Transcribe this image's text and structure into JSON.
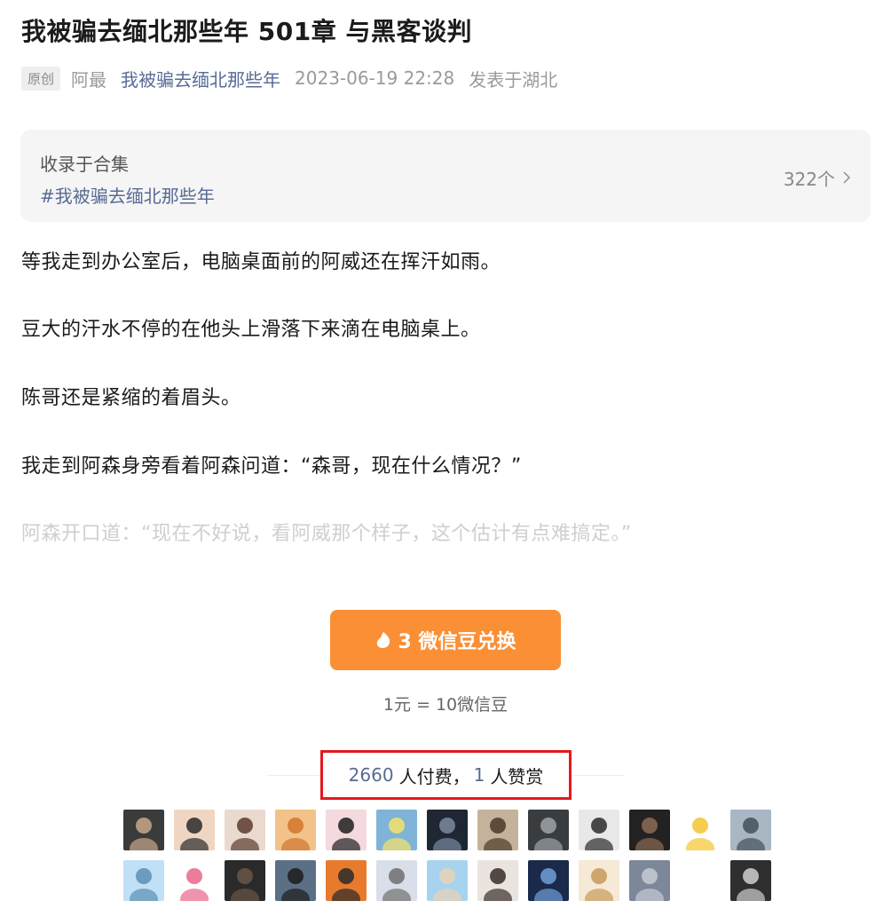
{
  "article": {
    "title": "我被骗去缅北那些年 501章 与黑客谈判",
    "original_tag": "原创",
    "author": "阿最",
    "account": "我被骗去缅北那些年",
    "datetime": "2023-06-19 22:28",
    "location": "发表于湖北"
  },
  "collection": {
    "label": "收录于合集",
    "tag": "#我被骗去缅北那些年",
    "count": "322个",
    "chevron_icon": "chevron-right-icon"
  },
  "paragraphs": [
    "等我走到办公室后，电脑桌面前的阿威还在挥汗如雨。",
    "豆大的汗水不停的在他头上滑落下来滴在电脑桌上。",
    "陈哥还是紧缩的着眉头。",
    "我走到阿森身旁看着阿森问道：“森哥，现在什么情况？”",
    "阿森开口道：“现在不好说，看阿威那个样子，这个估计有点难搞定。”"
  ],
  "payment": {
    "button_label": "3 微信豆兑换",
    "bean_icon": "wechat-bean-icon",
    "rate": "1元 = 10微信豆",
    "accent_color": "#fa8f35"
  },
  "stats": {
    "paid_count": "2660",
    "paid_label": "人付费，",
    "reward_count": "1",
    "reward_label": "人赞赏",
    "highlight_color": "#e4191c"
  },
  "avatars": {
    "row1": [
      {
        "color": "#3b3b3b",
        "accent": "#c9a88a"
      },
      {
        "color": "#f0d6c2",
        "accent": "#2a2a2a"
      },
      {
        "color": "#e9d9cf",
        "accent": "#5a3b2e"
      },
      {
        "color": "#f2c28a",
        "accent": "#d2752c"
      },
      {
        "color": "#f4d9df",
        "accent": "#1f1f1f"
      },
      {
        "color": "#7fb4d8",
        "accent": "#f5e26a"
      },
      {
        "color": "#1f2733",
        "accent": "#7b8aa0"
      },
      {
        "color": "#c6b29a",
        "accent": "#4b3a2a"
      },
      {
        "color": "#3a3d3f",
        "accent": "#9da3a8"
      },
      {
        "color": "#e8e8e8",
        "accent": "#2b2b2b"
      },
      {
        "color": "#222222",
        "accent": "#8c6b52"
      },
      {
        "color": "#ffffff",
        "accent": "#f4c430"
      },
      {
        "color": "#a9b7c4",
        "accent": "#44505c"
      }
    ],
    "row2": [
      {
        "color": "#bfe0f5",
        "accent": "#5b8fb5"
      },
      {
        "color": "#ffffff",
        "accent": "#e8668a"
      },
      {
        "color": "#2a2a2a",
        "accent": "#6b5647"
      },
      {
        "color": "#5b6f85",
        "accent": "#1c1c1c"
      },
      {
        "color": "#e87a2e",
        "accent": "#2a2a2a"
      },
      {
        "color": "#d9dfe8",
        "accent": "#6f6f6f"
      },
      {
        "color": "#a7d3ef",
        "accent": "#e9d2b4"
      },
      {
        "color": "#e9e4e0",
        "accent": "#3a2d27"
      },
      {
        "color": "#1b2a4a",
        "accent": "#6fa0d8"
      },
      {
        "color": "#f6e9d6",
        "accent": "#c79a5a"
      },
      {
        "color": "#7c8799",
        "accent": "#c7cbd4"
      },
      {
        "color": "transparent",
        "accent": "transparent"
      },
      {
        "color": "#2f2f2f",
        "accent": "#cfcfcf"
      }
    ]
  }
}
